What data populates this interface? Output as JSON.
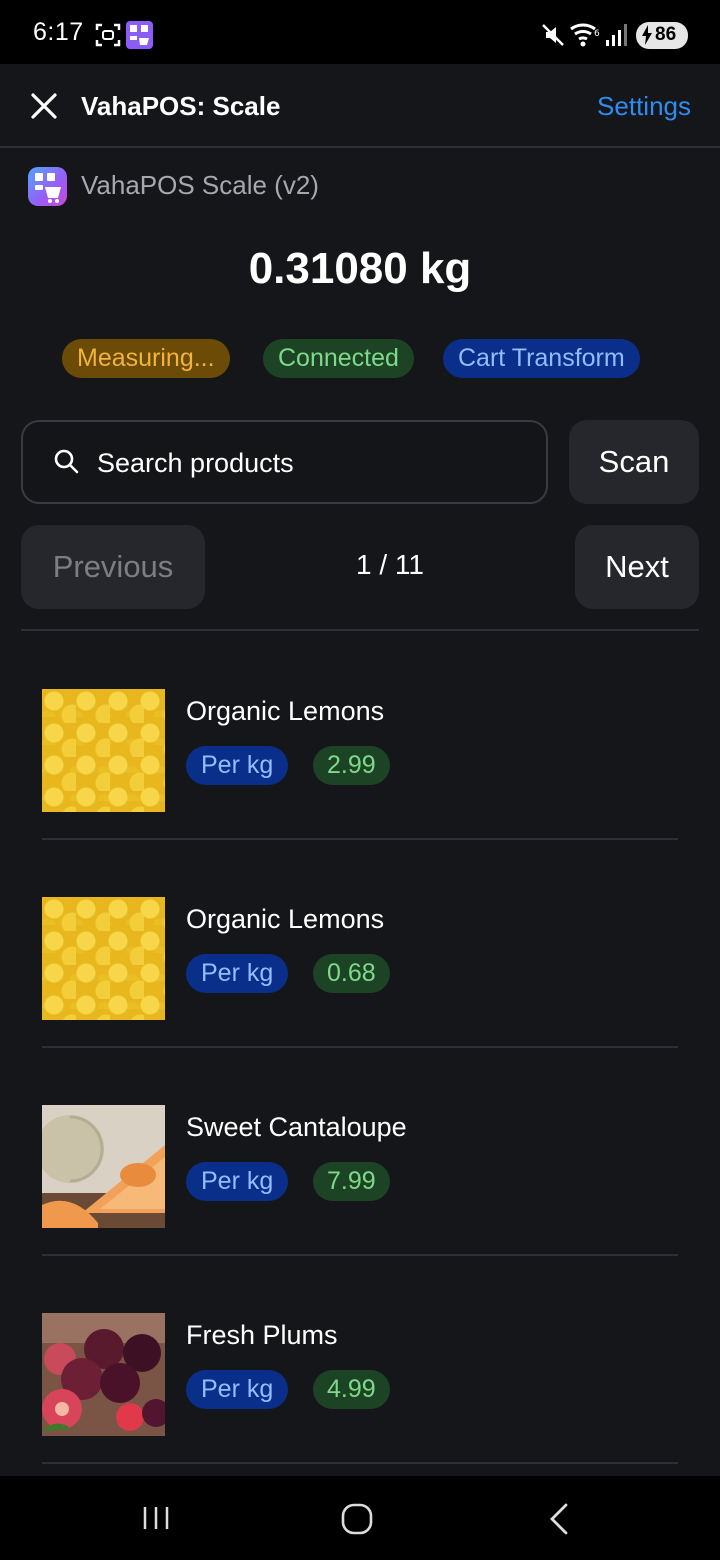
{
  "status_bar": {
    "time": "6:17",
    "battery": "86"
  },
  "header": {
    "title": "VahaPOS: Scale",
    "settings_label": "Settings"
  },
  "app": {
    "name": "VahaPOS Scale (v2)"
  },
  "weight": "0.31080 kg",
  "status_pills": {
    "measuring": "Measuring...",
    "connected": "Connected",
    "cart": "Cart Transform"
  },
  "search": {
    "placeholder": "Search products",
    "scan_label": "Scan"
  },
  "pager": {
    "previous_label": "Previous",
    "next_label": "Next",
    "page_indicator": "1 / 11"
  },
  "products": [
    {
      "name": "Organic Lemons",
      "unit": "Per kg",
      "price": "2.99",
      "image": "lemons-photo"
    },
    {
      "name": "Organic Lemons",
      "unit": "Per kg",
      "price": "0.68",
      "image": "lemons-photo"
    },
    {
      "name": "Sweet Cantaloupe",
      "unit": "Per kg",
      "price": "7.99",
      "image": "cantaloupe-photo"
    },
    {
      "name": "Fresh Plums",
      "unit": "Per kg",
      "price": "4.99",
      "image": "plums-photo"
    }
  ],
  "colors": {
    "background": "#15161a",
    "accent_link": "#2f8cf0",
    "measuring": "#f2b33d",
    "connected": "#7fd98a",
    "cart": "#93bcff"
  }
}
